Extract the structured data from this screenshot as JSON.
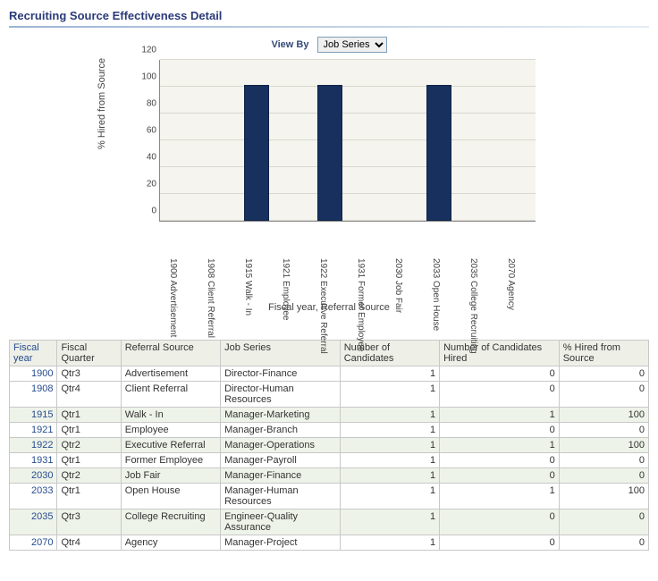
{
  "title": "Recruiting Source Effectiveness Detail",
  "viewby": {
    "label": "View By",
    "selected": "Job Series",
    "options": [
      "Job Series"
    ]
  },
  "chart_data": {
    "type": "bar",
    "ylabel": "% Hired from Source",
    "xlabel": "Fiscal year, Referral Source",
    "ylim": [
      0,
      120
    ],
    "yticks": [
      0,
      20,
      40,
      60,
      80,
      100,
      120
    ],
    "categories": [
      "1900 Advertisement",
      "1908 Client Referral",
      "1915 Walk - In",
      "1921 Employee",
      "1922 Executive Referral",
      "1931 Former Employee",
      "2030 Job Fair",
      "2033 Open House",
      "2035 College Recruiting",
      "2070 Agency"
    ],
    "values": [
      0,
      0,
      100,
      0,
      100,
      0,
      0,
      100,
      0,
      0
    ]
  },
  "table": {
    "headers": {
      "fiscal_year": "Fiscal year",
      "fiscal_quarter": "Fiscal Quarter",
      "referral_source": "Referral Source",
      "job_series": "Job Series",
      "num_candidates": "Number of Candidates",
      "num_hired": "Number of Candidates Hired",
      "pct_hired": "% Hired from Source"
    },
    "rows": [
      {
        "fy": "1900",
        "fq": "Qtr3",
        "rs": "Advertisement",
        "js": "Director-Finance",
        "nc": "1",
        "nh": "0",
        "ph": "0",
        "alt": false
      },
      {
        "fy": "1908",
        "fq": "Qtr4",
        "rs": "Client Referral",
        "js": "Director-Human Resources",
        "nc": "1",
        "nh": "0",
        "ph": "0",
        "alt": false
      },
      {
        "fy": "1915",
        "fq": "Qtr1",
        "rs": "Walk - In",
        "js": "Manager-Marketing",
        "nc": "1",
        "nh": "1",
        "ph": "100",
        "alt": true
      },
      {
        "fy": "1921",
        "fq": "Qtr1",
        "rs": "Employee",
        "js": "Manager-Branch",
        "nc": "1",
        "nh": "0",
        "ph": "0",
        "alt": false
      },
      {
        "fy": "1922",
        "fq": "Qtr2",
        "rs": "Executive Referral",
        "js": "Manager-Operations",
        "nc": "1",
        "nh": "1",
        "ph": "100",
        "alt": true
      },
      {
        "fy": "1931",
        "fq": "Qtr1",
        "rs": "Former Employee",
        "js": "Manager-Payroll",
        "nc": "1",
        "nh": "0",
        "ph": "0",
        "alt": false
      },
      {
        "fy": "2030",
        "fq": "Qtr2",
        "rs": "Job Fair",
        "js": "Manager-Finance",
        "nc": "1",
        "nh": "0",
        "ph": "0",
        "alt": true
      },
      {
        "fy": "2033",
        "fq": "Qtr1",
        "rs": "Open House",
        "js": "Manager-Human Resources",
        "nc": "1",
        "nh": "1",
        "ph": "100",
        "alt": false
      },
      {
        "fy": "2035",
        "fq": "Qtr3",
        "rs": "College Recruiting",
        "js": "Engineer-Quality Assurance",
        "nc": "1",
        "nh": "0",
        "ph": "0",
        "alt": true
      },
      {
        "fy": "2070",
        "fq": "Qtr4",
        "rs": "Agency",
        "js": "Manager-Project",
        "nc": "1",
        "nh": "0",
        "ph": "0",
        "alt": false
      }
    ]
  }
}
